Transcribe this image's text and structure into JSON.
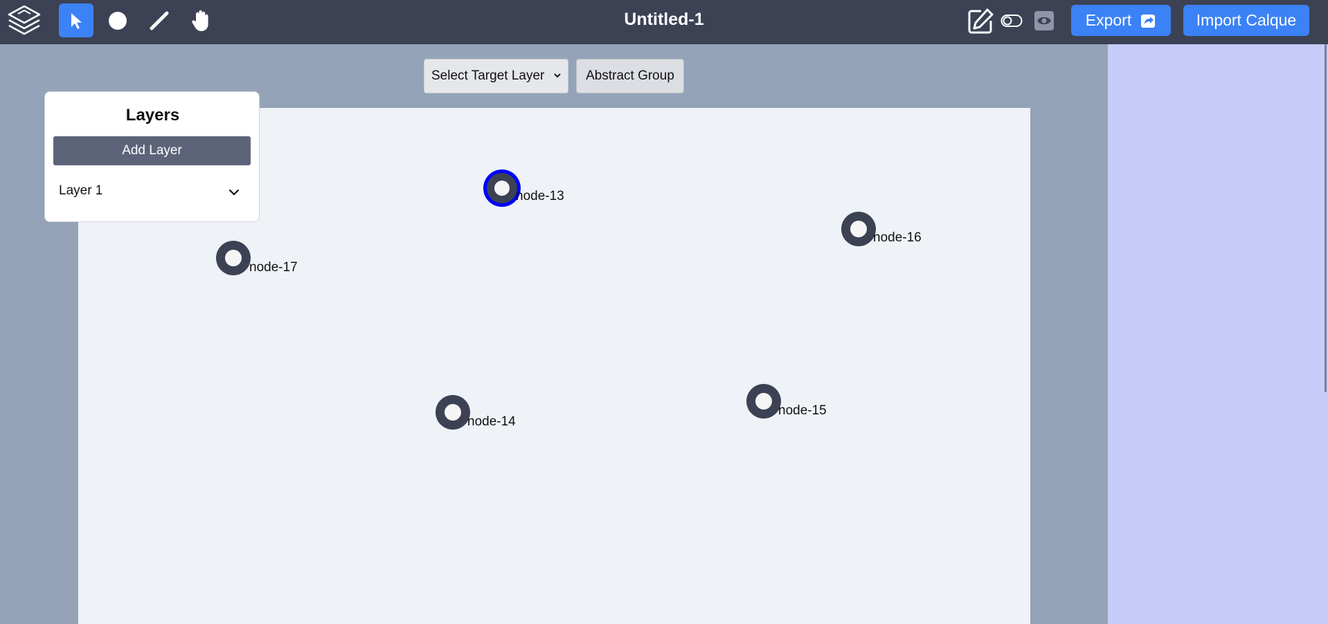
{
  "header": {
    "document_title": "Untitled-1",
    "tools": [
      {
        "name": "select",
        "icon": "cursor-arrow-icon",
        "active": true
      },
      {
        "name": "node",
        "icon": "circle-icon",
        "active": false
      },
      {
        "name": "edge",
        "icon": "line-icon",
        "active": false
      },
      {
        "name": "pan",
        "icon": "hand-icon",
        "active": false
      }
    ],
    "export_label": "Export",
    "import_label": "Import Calque"
  },
  "canvas_toolbar": {
    "select_target_layer": "Select Target Layer",
    "abstract_group": "Abstract Group"
  },
  "layers_panel": {
    "title": "Layers",
    "add_layer_label": "Add Layer",
    "layers": [
      {
        "label": "Layer 1"
      }
    ]
  },
  "graph": {
    "nodes": [
      {
        "id": "node-13",
        "selected": true
      },
      {
        "id": "node-16",
        "selected": false
      },
      {
        "id": "node-17",
        "selected": false
      },
      {
        "id": "node-14",
        "selected": false
      },
      {
        "id": "node-15",
        "selected": false
      }
    ]
  },
  "colors": {
    "topbar": "#3c4254",
    "accent": "#3b82f6",
    "node": "#3c4254",
    "selected_ring": "#0000ff",
    "canvas": "#eff2f7",
    "right_panel": "#c7cbf7"
  }
}
